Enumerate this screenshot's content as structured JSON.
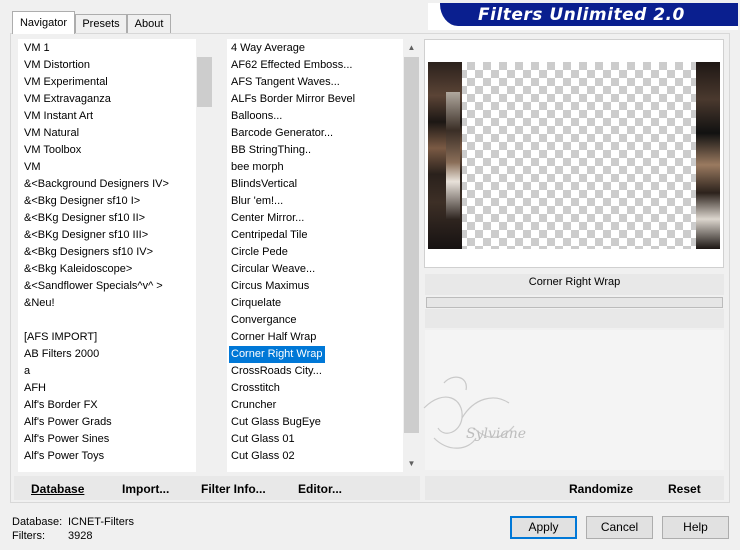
{
  "tabs": [
    "Navigator",
    "Presets",
    "About"
  ],
  "active_tab": 0,
  "title_banner": "Filters Unlimited 2.0",
  "categories": [
    "VM 1",
    "VM Distortion",
    "VM Experimental",
    "VM Extravaganza",
    "VM Instant Art",
    "VM Natural",
    "VM Toolbox",
    "VM",
    "&<Background Designers IV>",
    "&<Bkg Designer sf10 I>",
    "&<BKg Designer sf10 II>",
    "&<BKg Designer sf10 III>",
    "&<Bkg Designers sf10 IV>",
    "&<Bkg Kaleidoscope>",
    "&<Sandflower Specials^v^ >",
    "&Neu!",
    "",
    "[AFS IMPORT]",
    "AB Filters 2000",
    "a",
    "AFH",
    "Alf's Border FX",
    "Alf's Power Grads",
    "Alf's Power Sines",
    "Alf's Power Toys"
  ],
  "filters": [
    "4 Way Average",
    "AF62 Effected Emboss...",
    "AFS Tangent Waves...",
    "ALFs Border Mirror Bevel",
    "Balloons...",
    "Barcode Generator...",
    "BB StringThing..",
    "bee morph",
    "BlindsVertical",
    "Blur 'em!...",
    "Center Mirror...",
    "Centripedal Tile",
    "Circle Pede",
    "Circular Weave...",
    "Circus Maximus",
    "Cirquelate",
    "Convergance",
    "Corner Half Wrap",
    "Corner Right Wrap",
    "CrossRoads City...",
    "Crosstitch",
    "Cruncher",
    "Cut Glass  BugEye",
    "Cut Glass 01",
    "Cut Glass 02"
  ],
  "selected_filter_index": 18,
  "selected_filter_name": "Corner Right Wrap",
  "toolbar": {
    "database": "Database",
    "import": "Import...",
    "filter_info": "Filter Info...",
    "editor": "Editor...",
    "randomize": "Randomize",
    "reset": "Reset"
  },
  "status": {
    "database_label": "Database:",
    "database_value": "ICNET-Filters",
    "filters_label": "Filters:",
    "filters_value": "3928"
  },
  "buttons": {
    "apply": "Apply",
    "cancel": "Cancel",
    "help": "Help"
  },
  "watermark": "Sylviane",
  "colors": {
    "banner": "#0a1f8f",
    "selection": "#0078d7"
  }
}
